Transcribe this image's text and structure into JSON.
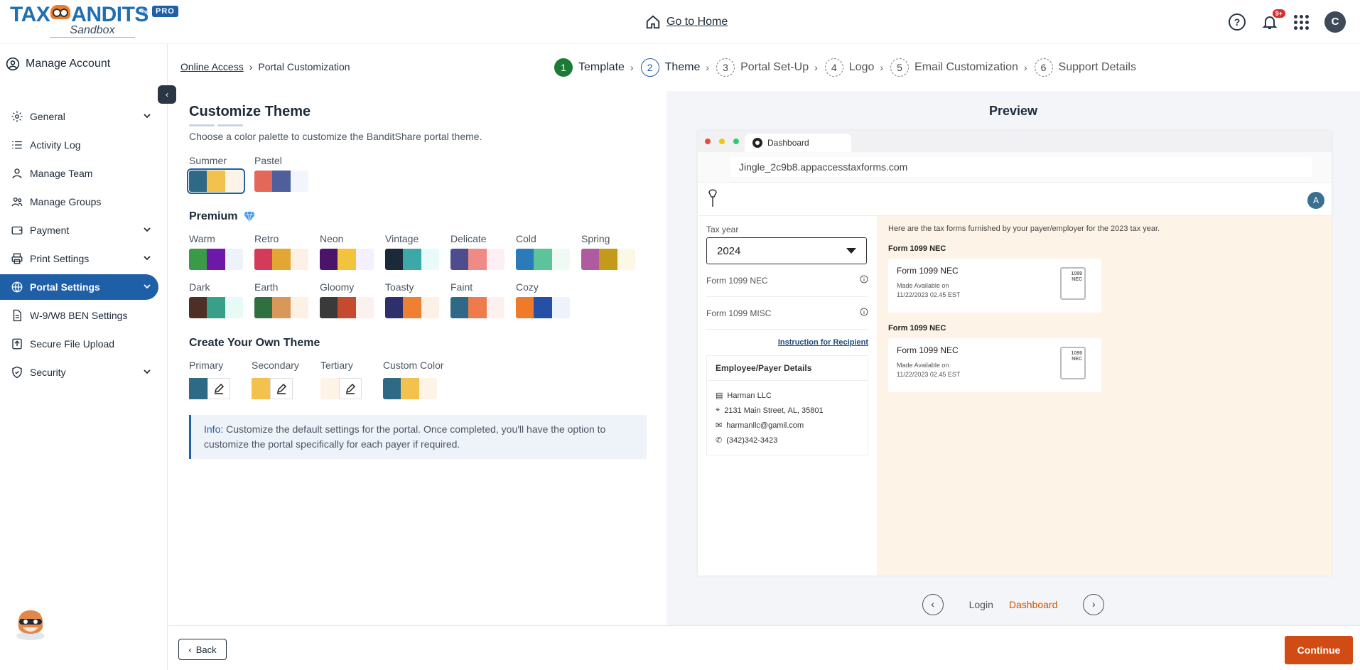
{
  "header": {
    "logo_main_left": "TAX",
    "logo_main_right": "ANDITS",
    "logo_sub": "Sandbox",
    "pro_badge": "PRO",
    "go_home": "Go to Home",
    "notif_badge": "9+",
    "avatar_initial": "C"
  },
  "sidebar": {
    "manage_account": "Manage Account",
    "items": [
      {
        "label": "General",
        "icon": "gear-icon",
        "has_chevron": true
      },
      {
        "label": "Activity Log",
        "icon": "list-icon",
        "has_chevron": false
      },
      {
        "label": "Manage Team",
        "icon": "user-icon",
        "has_chevron": false
      },
      {
        "label": "Manage Groups",
        "icon": "users-icon",
        "has_chevron": false
      },
      {
        "label": "Payment",
        "icon": "wallet-icon",
        "has_chevron": true
      },
      {
        "label": "Print Settings",
        "icon": "printer-icon",
        "has_chevron": true
      },
      {
        "label": "Portal Settings",
        "icon": "globe-icon",
        "has_chevron": true,
        "active": true
      },
      {
        "label": "W-9/W8 BEN Settings",
        "icon": "document-icon",
        "has_chevron": false
      },
      {
        "label": "Secure File Upload",
        "icon": "upload-icon",
        "has_chevron": false
      },
      {
        "label": "Security",
        "icon": "shield-icon",
        "has_chevron": true
      }
    ]
  },
  "breadcrumb": {
    "link": "Online Access",
    "current": "Portal Customization"
  },
  "stepper": [
    {
      "num": "1",
      "label": "Template",
      "state": "done"
    },
    {
      "num": "2",
      "label": "Theme",
      "state": "current"
    },
    {
      "num": "3",
      "label": "Portal Set-Up",
      "state": "todo"
    },
    {
      "num": "4",
      "label": "Logo",
      "state": "todo"
    },
    {
      "num": "5",
      "label": "Email Customization",
      "state": "todo"
    },
    {
      "num": "6",
      "label": "Support Details",
      "state": "todo"
    }
  ],
  "theme": {
    "title": "Customize Theme",
    "subtitle": "Choose a color palette to customize the BanditShare portal theme.",
    "basic": [
      {
        "name": "Summer",
        "colors": [
          "#2e6a86",
          "#f2c14e",
          "#fdf4e7"
        ],
        "selected": true
      },
      {
        "name": "Pastel",
        "colors": [
          "#e4685a",
          "#4e5f9c",
          "#f2f5fd"
        ],
        "selected": false
      }
    ],
    "premium_title": "Premium",
    "premium": [
      {
        "name": "Warm",
        "colors": [
          "#3a9a48",
          "#6d18a8",
          "#eef3fb"
        ]
      },
      {
        "name": "Retro",
        "colors": [
          "#d43b5a",
          "#e3a633",
          "#fdf1e5"
        ]
      },
      {
        "name": "Neon",
        "colors": [
          "#4c136b",
          "#f2c43d",
          "#f5f0fd"
        ]
      },
      {
        "name": "Vintage",
        "colors": [
          "#1b2a3a",
          "#3ca8a8",
          "#e9fafa"
        ]
      },
      {
        "name": "Delicate",
        "colors": [
          "#4f4c8e",
          "#ef8a86",
          "#fdeff3"
        ]
      },
      {
        "name": "Cold",
        "colors": [
          "#2b7bbb",
          "#5cc39a",
          "#effaf5"
        ]
      },
      {
        "name": "Spring",
        "colors": [
          "#b05aa0",
          "#c49a1c",
          "#fdf7e5"
        ]
      },
      {
        "name": "Dark",
        "colors": [
          "#4e2f25",
          "#38a088",
          "#e8faf5"
        ]
      },
      {
        "name": "Earth",
        "colors": [
          "#2f7040",
          "#d9975a",
          "#fdf0e5"
        ]
      },
      {
        "name": "Gloomy",
        "colors": [
          "#3a3a3a",
          "#c44b30",
          "#fbf1ef"
        ]
      },
      {
        "name": "Toasty",
        "colors": [
          "#2e2f6d",
          "#f08031",
          "#fdf1e6"
        ]
      },
      {
        "name": "Faint",
        "colors": [
          "#2e6a86",
          "#ef7a4e",
          "#fdf0ee"
        ]
      },
      {
        "name": "Cozy",
        "colors": [
          "#ef7b2a",
          "#2450a8",
          "#eef2fd"
        ]
      }
    ],
    "own_title": "Create Your Own Theme",
    "own": [
      {
        "label": "Primary",
        "color": "#2e6a86"
      },
      {
        "label": "Secondary",
        "color": "#f2c14e"
      },
      {
        "label": "Tertiary",
        "color": "#fdf4e7"
      }
    ],
    "custom_label": "Custom Color",
    "custom_colors": [
      "#2e6a86",
      "#f2c14e",
      "#fdf4e7"
    ],
    "info_prefix": "Info:",
    "info_text": " Customize the default settings for the portal. Once completed, you'll have the option to customize the portal specifically for each payer if required."
  },
  "preview": {
    "title": "Preview",
    "tab_label": "Dashboard",
    "url": "Jingle_2c9b8.appaccesstaxforms.com",
    "portal_avatar": "A",
    "tax_year_label": "Tax year",
    "tax_year": "2024",
    "forms": [
      "Form 1099 NEC",
      "Form 1099 MISC"
    ],
    "instruction_link": "Instruction for Recipient",
    "employee": {
      "title": "Employee/Payer Details",
      "name": "Harman LLC",
      "address": "2131 Main Street, AL, 35801",
      "email": "harmanllc@gamil.com",
      "phone": "(342)342-3423"
    },
    "intro": "Here are the tax forms furnished by your payer/employer for the 2023 tax year.",
    "cards": [
      {
        "heading": "Form 1099 NEC",
        "title": "Form 1099 NEC",
        "sub1": "Made Available on",
        "sub2": "11/22/2023 02.45 EST",
        "doc": "1099 NEC"
      },
      {
        "heading": "Form 1099 NEC",
        "title": "Form 1099 NEC",
        "sub1": "Made Available on",
        "sub2": "11/22/2023 02.45 EST",
        "doc": "1099 NEC"
      }
    ],
    "nav_login": "Login",
    "nav_dashboard": "Dashboard"
  },
  "footer": {
    "back": "Back",
    "continue": "Continue"
  }
}
